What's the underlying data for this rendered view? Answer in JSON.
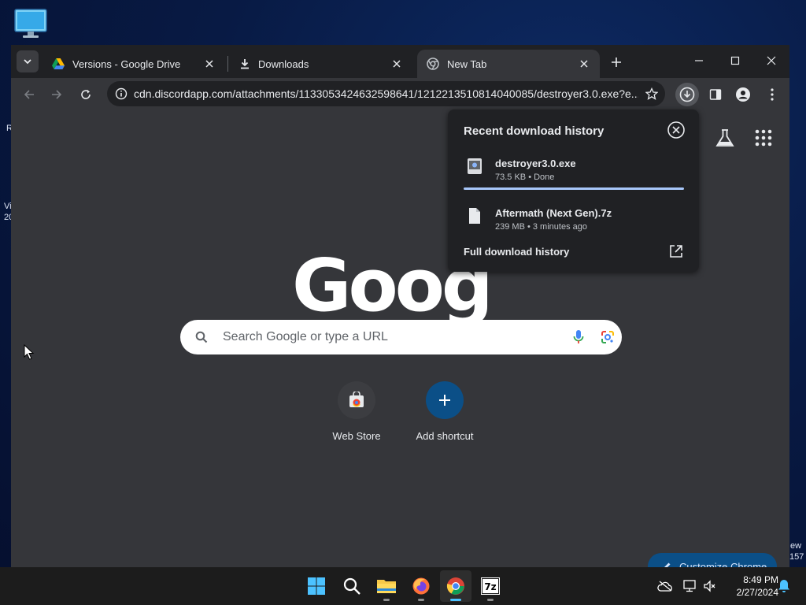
{
  "desktop": {
    "edge_text_1": "R",
    "edge_text_2": "Vi",
    "edge_text_3": "20",
    "edge_text_right_1": "ew",
    "edge_text_right_2": "157"
  },
  "browser": {
    "tabs": [
      {
        "title": "Versions - Google Drive",
        "icon": "google-drive-icon",
        "active": false
      },
      {
        "title": "Downloads",
        "icon": "download-icon",
        "active": false
      },
      {
        "title": "New Tab",
        "icon": "chrome-icon",
        "active": true
      }
    ],
    "url": "cdn.discordapp.com/attachments/1133053424632598641/1212213510814040085/destroyer3.0.exe?e..."
  },
  "newtab": {
    "logo_text": "Goog",
    "search_placeholder": "Search Google or type a URL",
    "shortcuts": [
      {
        "label": "Web Store",
        "icon": "web-store-icon"
      },
      {
        "label": "Add shortcut",
        "icon": "plus-icon"
      }
    ],
    "customize_label": "Customize Chrome"
  },
  "download_bubble": {
    "title": "Recent download history",
    "items": [
      {
        "name": "destroyer3.0.exe",
        "meta": "73.5 KB • Done",
        "icon": "exe-file-icon",
        "progress": 1.0
      },
      {
        "name": "Aftermath (Next Gen).7z",
        "meta": "239 MB • 3 minutes ago",
        "icon": "file-icon"
      }
    ],
    "full_history_label": "Full download history"
  },
  "taskbar": {
    "apps": [
      "start-icon",
      "search-icon",
      "file-explorer-icon",
      "firefox-icon",
      "chrome-icon",
      "7zip-icon"
    ],
    "time": "8:49 PM",
    "date": "2/27/2024"
  },
  "colors": {
    "accent": "#a8c7fa",
    "window_bg": "#35363a",
    "tabstrip_bg": "#202124",
    "customize_bg": "#0b4f87"
  }
}
